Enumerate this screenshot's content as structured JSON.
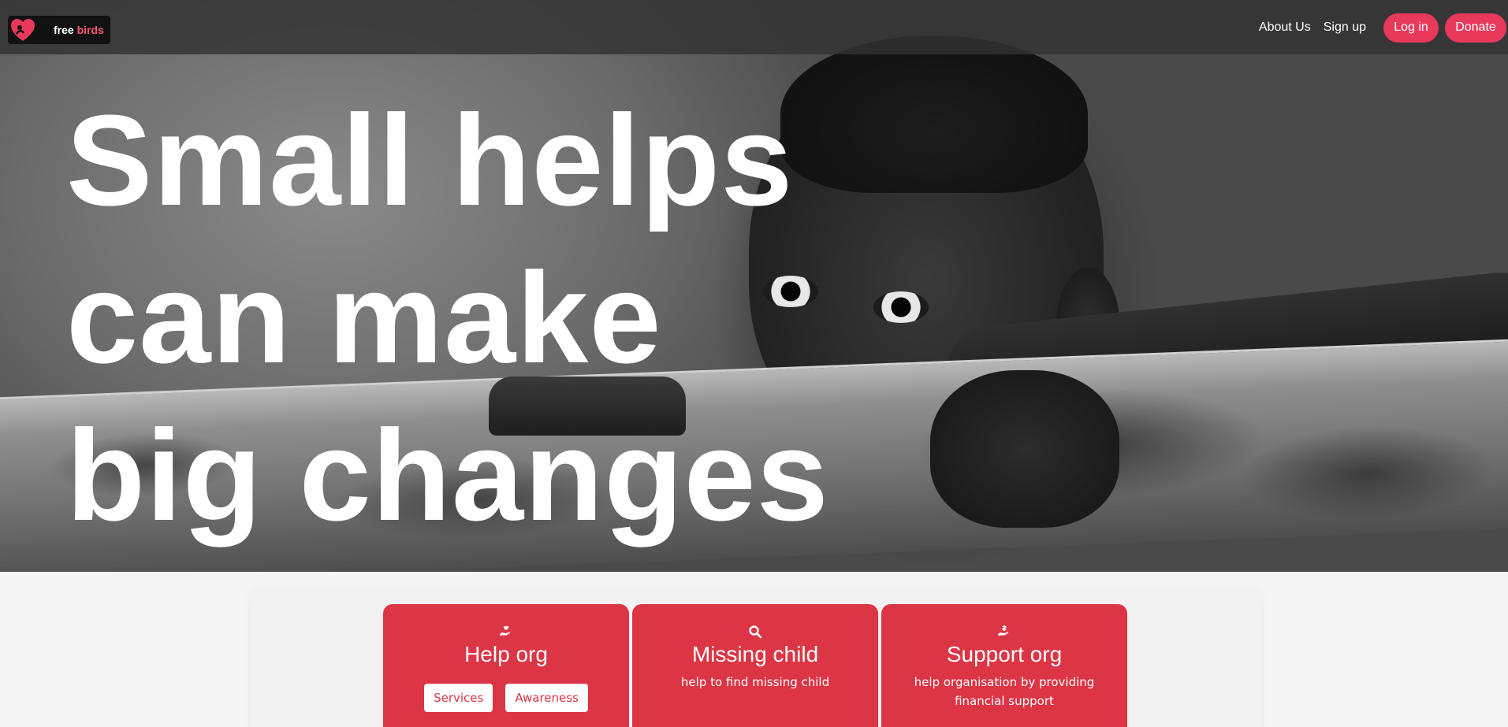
{
  "brand": {
    "word1": "free",
    "word2": "birds"
  },
  "nav": {
    "about_label": "About Us",
    "signup_label": "Sign up",
    "login_label": "Log in",
    "donate_label": "Donate"
  },
  "hero": {
    "line1": "Small helps",
    "line2": "can make",
    "line3": "big changes"
  },
  "cards": [
    {
      "icon": "hand-holding-heart-icon",
      "title": "Help org",
      "buttons": [
        "Services",
        "Awareness"
      ]
    },
    {
      "icon": "search-icon",
      "title": "Missing child",
      "desc": "help to find missing child"
    },
    {
      "icon": "hand-holding-dollar-icon",
      "title": "Support org",
      "desc": "help organisation by providing financial support"
    }
  ],
  "colors": {
    "accent": "#dc3545",
    "pill": "#e8395b",
    "logo_accent": "#ff5a6e"
  }
}
